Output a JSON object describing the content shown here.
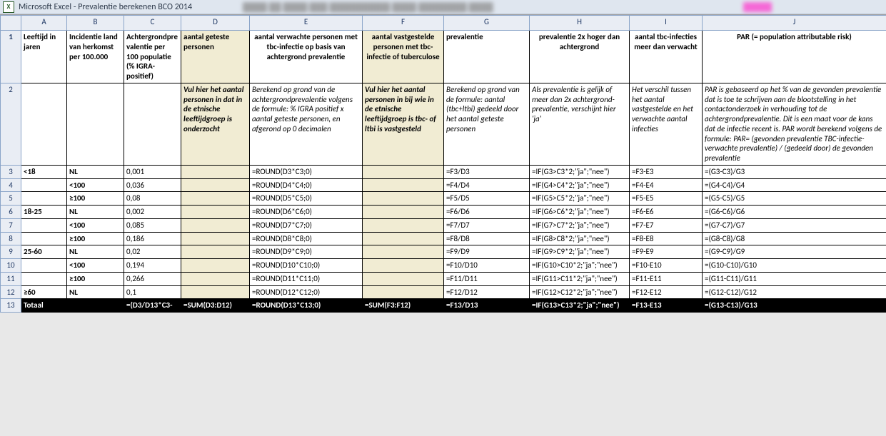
{
  "title": "Microsoft Excel - Prevalentie berekenen BCO 2014",
  "excel_icon_glyph": "X",
  "columns": [
    "A",
    "B",
    "C",
    "D",
    "E",
    "F",
    "G",
    "H",
    "I",
    "J"
  ],
  "row_numbers": [
    "1",
    "2",
    "3",
    "4",
    "5",
    "6",
    "7",
    "8",
    "9",
    "10",
    "11",
    "12",
    "13"
  ],
  "headers": {
    "A": "Leeftijd in jaren",
    "B": "Incidentie land van herkomst per 100.000",
    "C": "Achtergrondprevalentie per 100 populatie (% IGRA-positief)",
    "D": "aantal geteste personen",
    "E": "aantal verwachte personen met tbc-infectie op basis van achtergrond prevalentie",
    "F": "aantal vastgestelde personen met tbc-infectie of tuberculose",
    "G": "prevalentie",
    "H": "prevalentie 2x hoger dan achtergrond",
    "I": "aantal tbc-infecties meer dan verwacht",
    "J": "PAR (= population attributable risk)"
  },
  "descriptions": {
    "D": "Vul hier het aantal personen in dat in de etnische leeftijdgroep is onderzocht",
    "E": "Berekend op grond van de achtergrondprevalentie volgens de formule: % IGRA positief x aantal geteste personen, en afgerond op 0 decimalen",
    "F": "Vul hier het aantal personen in bij wie in de etnische leeftijdgroep is tbc- of ltbi is vastgesteld",
    "G": "Berekend op grond van de formule: aantal (tbc+ltbi) gedeeld door het  aantal geteste personen",
    "H": "Als prevalentie is gelijk of meer dan 2x achtergrond-prevalentie, verschijnt hier 'ja'",
    "I": "Het verschil tussen het aantal vastgestelde en het verwachte aantal infecties",
    "J": "PAR is gebaseerd op het % van de gevonden prevalentie dat is toe te schrijven aan de blootstelling in het contactonderzoek in verhouding tot de achtergrondprevalentie. Dit is een maat voor de kans dat de infectie recent is. PAR wordt berekend volgens de formule: PAR= (gevonden prevalentie TBC-infectie- verwachte prevalentie) / (gedeeld door) de gevonden prevalentie"
  },
  "rows": [
    {
      "A": "<18",
      "B": "NL",
      "C": "0,001",
      "D": "",
      "E": "=ROUND(D3*C3;0)",
      "F": "",
      "G": "=F3/D3",
      "H": "=IF(G3>C3*2;\"ja\";\"nee\")",
      "I": "=F3-E3",
      "J": "=(G3-C3)/G3"
    },
    {
      "A": "",
      "B": "<100",
      "C": "0,036",
      "D": "",
      "E": "=ROUND(D4*C4;0)",
      "F": "",
      "G": "=F4/D4",
      "H": "=IF(G4>C4*2;\"ja\";\"nee\")",
      "I": "=F4-E4",
      "J": "=(G4-C4)/G4"
    },
    {
      "A": "",
      "B": "≥100",
      "C": "0,08",
      "D": "",
      "E": "=ROUND(D5*C5;0)",
      "F": "",
      "G": "=F5/D5",
      "H": "=IF(G5>C5*2;\"ja\";\"nee\")",
      "I": "=F5-E5",
      "J": "=(G5-C5)/G5"
    },
    {
      "A": "18-25",
      "B": "NL",
      "C": "0,002",
      "D": "",
      "E": "=ROUND(D6*C6;0)",
      "F": "",
      "G": "=F6/D6",
      "H": "=IF(G6>C6*2;\"ja\";\"nee\")",
      "I": "=F6-E6",
      "J": "=(G6-C6)/G6"
    },
    {
      "A": "",
      "B": "<100",
      "C": "0,085",
      "D": "",
      "E": "=ROUND(D7*C7;0)",
      "F": "",
      "G": "=F7/D7",
      "H": "=IF(G7>C7*2;\"ja\";\"nee\")",
      "I": "=F7-E7",
      "J": "=(G7-C7)/G7"
    },
    {
      "A": "",
      "B": "≥100",
      "C": "0,186",
      "D": "",
      "E": "=ROUND(D8*C8;0)",
      "F": "",
      "G": "=F8/D8",
      "H": "=IF(G8>C8*2;\"ja\";\"nee\")",
      "I": "=F8-E8",
      "J": "=(G8-C8)/G8"
    },
    {
      "A": "25-60",
      "B": "NL",
      "C": "0,02",
      "D": "",
      "E": "=ROUND(D9*C9;0)",
      "F": "",
      "G": "=F9/D9",
      "H": "=IF(G9>C9*2;\"ja\";\"nee\")",
      "I": "=F9-E9",
      "J": "=(G9-C9)/G9"
    },
    {
      "A": "",
      "B": "<100",
      "C": "0,194",
      "D": "",
      "E": "=ROUND(D10*C10;0)",
      "F": "",
      "G": "=F10/D10",
      "H": "=IF(G10>C10*2;\"ja\";\"nee\")",
      "I": "=F10-E10",
      "J": "=(G10-C10)/G10"
    },
    {
      "A": "",
      "B": "≥100",
      "C": "0,266",
      "D": "",
      "E": "=ROUND(D11*C11;0)",
      "F": "",
      "G": "=F11/D11",
      "H": "=IF(G11>C11*2;\"ja\";\"nee\")",
      "I": "=F11-E11",
      "J": "=(G11-C11)/G11"
    },
    {
      "A": "≥60",
      "B": "NL",
      "C": "0,1",
      "D": "",
      "E": "=ROUND(D12*C12;0)",
      "F": "",
      "G": "=F12/D12",
      "H": "=IF(G12>C12*2;\"ja\";\"nee\")",
      "I": "=F12-E12",
      "J": "=(G12-C12)/G12"
    }
  ],
  "totaal": {
    "label": "Totaal",
    "C": "=(D3/D13*C3-",
    "D": "=SUM(D3:D12)",
    "E": "=ROUND(D13*C13;0)",
    "F": "=SUM(F3:F12)",
    "G": "=F13/D13",
    "H": "=IF(G13>C13*2;\"ja\";\"nee\")",
    "I": "=F13-E13",
    "J": "=(G13-C13)/G13"
  }
}
